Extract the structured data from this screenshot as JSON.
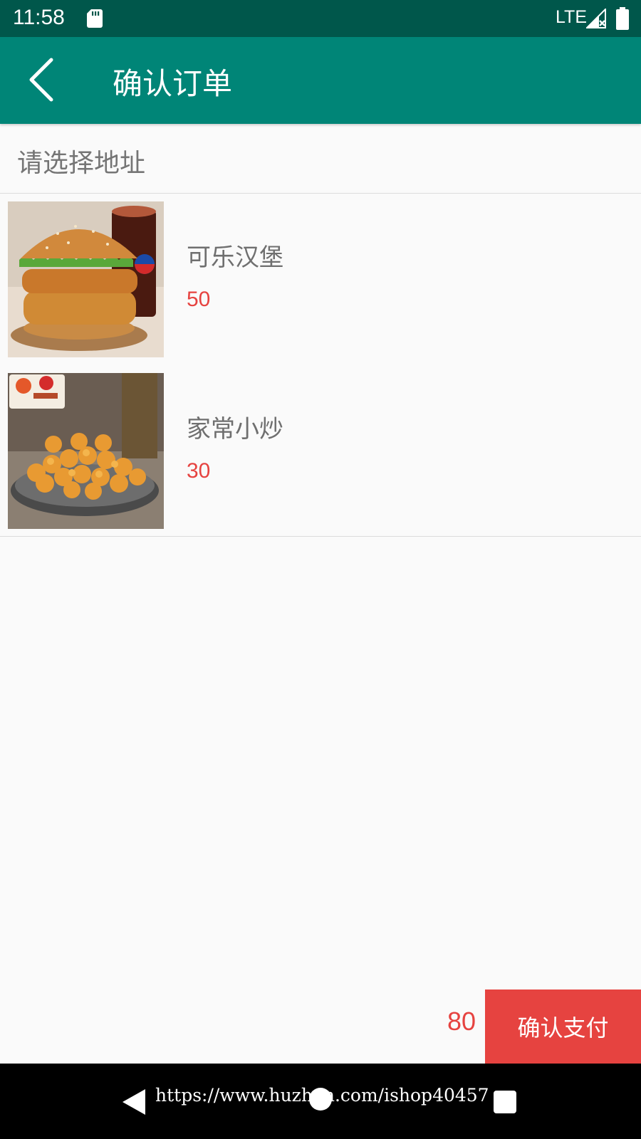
{
  "status_bar": {
    "time": "11:58",
    "network": "LTE",
    "icons": [
      "sd-card-icon",
      "signal-icon",
      "battery-icon"
    ]
  },
  "app_bar": {
    "title": "确认订单",
    "back_icon": "chevron-left-icon"
  },
  "address": {
    "label": "请选择地址"
  },
  "items": [
    {
      "name": "可乐汉堡",
      "price": "50",
      "image": "burger-and-cola-photo"
    },
    {
      "name": "家常小炒",
      "price": "30",
      "image": "fried-chicken-bites-photo"
    }
  ],
  "footer": {
    "total": "80",
    "pay_label": "确认支付"
  },
  "nav_bar": {
    "watermark": "https://www.huzhan.com/ishop40457"
  },
  "colors": {
    "status_bar": "#00574b",
    "app_bar": "#008577",
    "price_red": "#e64340",
    "pay_button": "#e64340"
  }
}
